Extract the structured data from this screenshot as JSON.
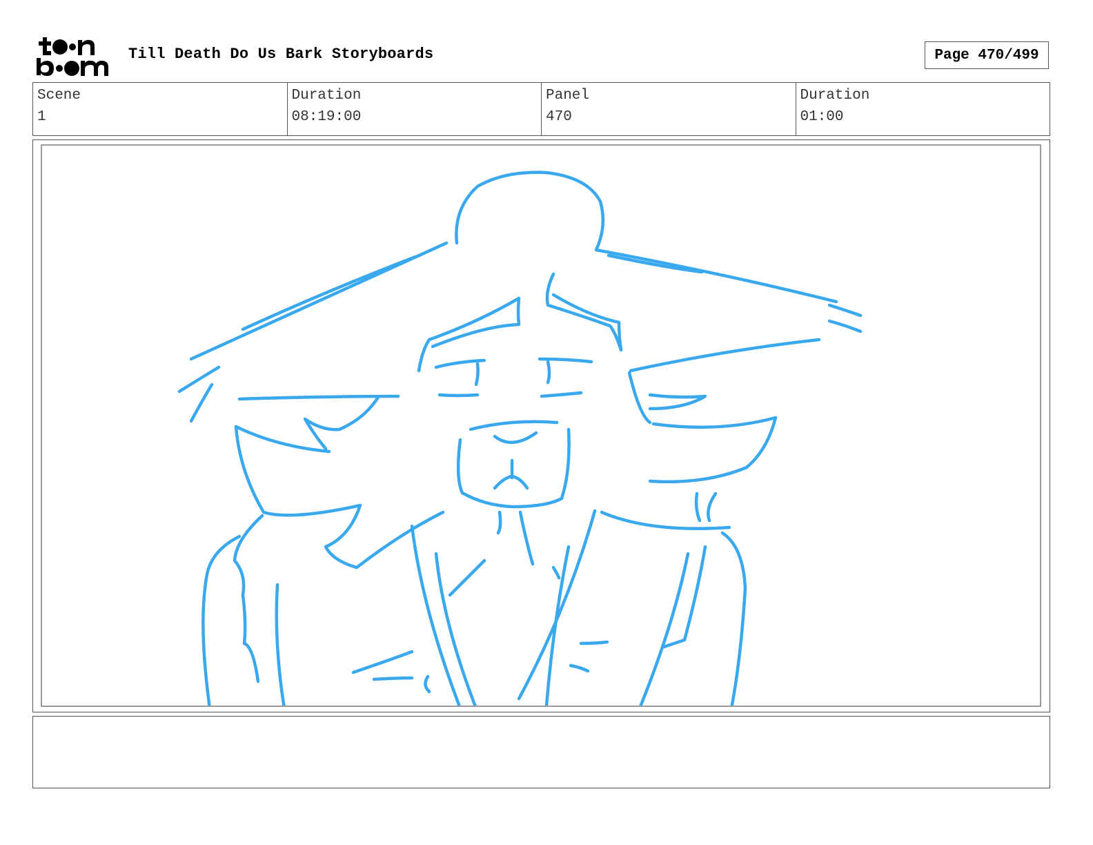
{
  "logo": {
    "icon": "toon-boom-logo",
    "text": "toon boom"
  },
  "header": {
    "title": "Till Death Do Us Bark Storyboards",
    "page": "Page 470/499"
  },
  "info": [
    {
      "label": "Scene",
      "value": "1"
    },
    {
      "label": "Duration",
      "value": "08:19:00"
    },
    {
      "label": "Panel",
      "value": "470"
    },
    {
      "label": "Duration",
      "value": "01:00"
    }
  ],
  "panel": {
    "sketch": "storyboard-sketch-icon",
    "sketch_color": "#3aa8ec"
  },
  "notes": {
    "text": ""
  }
}
